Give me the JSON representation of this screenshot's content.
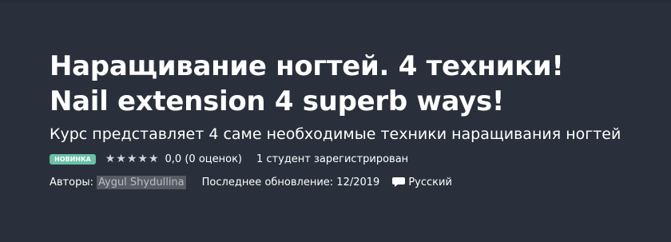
{
  "course": {
    "title": "Наращивание ногтей. 4 техники! Nail extension 4 superb ways!",
    "subtitle": "Курс представляет 4 саме необходимые техники наращивания ногтей",
    "badge": "Новинка",
    "rating_value": 5,
    "rating_max": 5,
    "rating_text": "0,0 (0 оценок)",
    "students_text": "1 студент зарегистрирован",
    "authors_label": "Авторы:",
    "author_name": "Aygul Shydullina",
    "updated_text": "Последнее обновление: 12/2019",
    "language": "Русский"
  },
  "icons": {
    "star": "star-icon",
    "language": "speech-bubble-icon"
  },
  "colors": {
    "background": "#29303b",
    "badge": "#69c1a7",
    "author_highlight": "#575c64"
  }
}
